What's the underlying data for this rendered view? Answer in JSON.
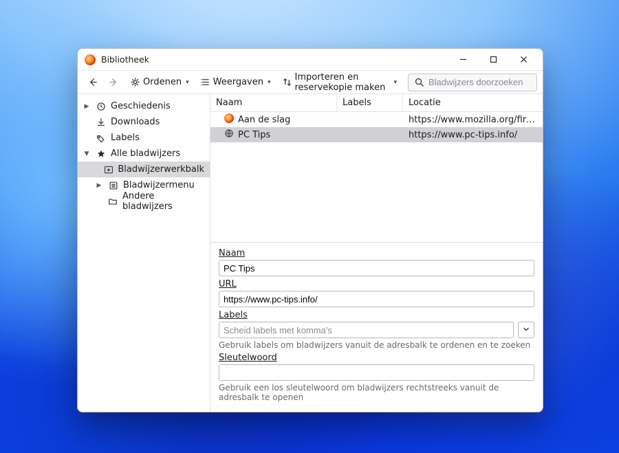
{
  "window": {
    "title": "Bibliotheek"
  },
  "toolbar": {
    "organize": "Ordenen",
    "views": "Weergaven",
    "importExport": "Importeren en reservekopie maken",
    "searchPlaceholder": "Bladwijzers doorzoeken"
  },
  "sidebar": {
    "history": "Geschiedenis",
    "downloads": "Downloads",
    "labels": "Labels",
    "allBookmarks": "Alle bladwijzers",
    "toolbar": "Bladwijzerwerkbalk",
    "menu": "Bladwijzermenu",
    "other": "Andere bladwijzers"
  },
  "columns": {
    "name": "Naam",
    "labels": "Labels",
    "location": "Locatie"
  },
  "rows": [
    {
      "name": "Aan de slag",
      "url": "https://www.mozilla.org/firefox/cen…",
      "icon": "firefox"
    },
    {
      "name": "PC Tips",
      "url": "https://www.pc-tips.info/",
      "icon": "globe",
      "selected": true
    }
  ],
  "details": {
    "nameLabel": "Naam",
    "nameValue": "PC Tips",
    "urlLabel": "URL",
    "urlValue": "https://www.pc-tips.info/",
    "labelsLabel": "Labels",
    "labelsPlaceholder": "Scheid labels met komma's",
    "labelsHint": "Gebruik labels om bladwijzers vanuit de adresbalk te ordenen en te zoeken",
    "keywordLabel": "Sleutelwoord",
    "keywordHint": "Gebruik een los sleutelwoord om bladwijzers rechtstreeks vanuit de adresbalk te openen"
  }
}
